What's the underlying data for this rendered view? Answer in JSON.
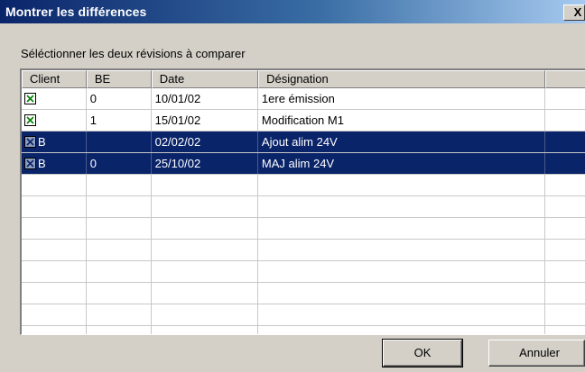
{
  "window": {
    "title": "Montrer les différences",
    "close_label": "X"
  },
  "instruction": "Séléctionner les deux révisions à comparer",
  "table": {
    "columns": [
      "Client",
      "BE",
      "Date",
      "Désignation",
      ""
    ],
    "rows": [
      {
        "checked": true,
        "selected": false,
        "client": "",
        "be": "0",
        "date": "10/01/02",
        "designation": "1ere émission"
      },
      {
        "checked": true,
        "selected": false,
        "client": "",
        "be": "1",
        "date": "15/01/02",
        "designation": "Modification M1"
      },
      {
        "checked": true,
        "selected": true,
        "client": "B",
        "be": "",
        "date": "02/02/02",
        "designation": "Ajout alim 24V"
      },
      {
        "checked": true,
        "selected": true,
        "client": "B",
        "be": "0",
        "date": "25/10/02",
        "designation": "MAJ alim 24V"
      }
    ],
    "empty_rows": 8
  },
  "buttons": {
    "ok": "OK",
    "cancel": "Annuler"
  },
  "colors": {
    "title_start": "#0a246a",
    "title_end": "#a6caf0",
    "selection": "#0a246a",
    "check_green": "#008000"
  }
}
